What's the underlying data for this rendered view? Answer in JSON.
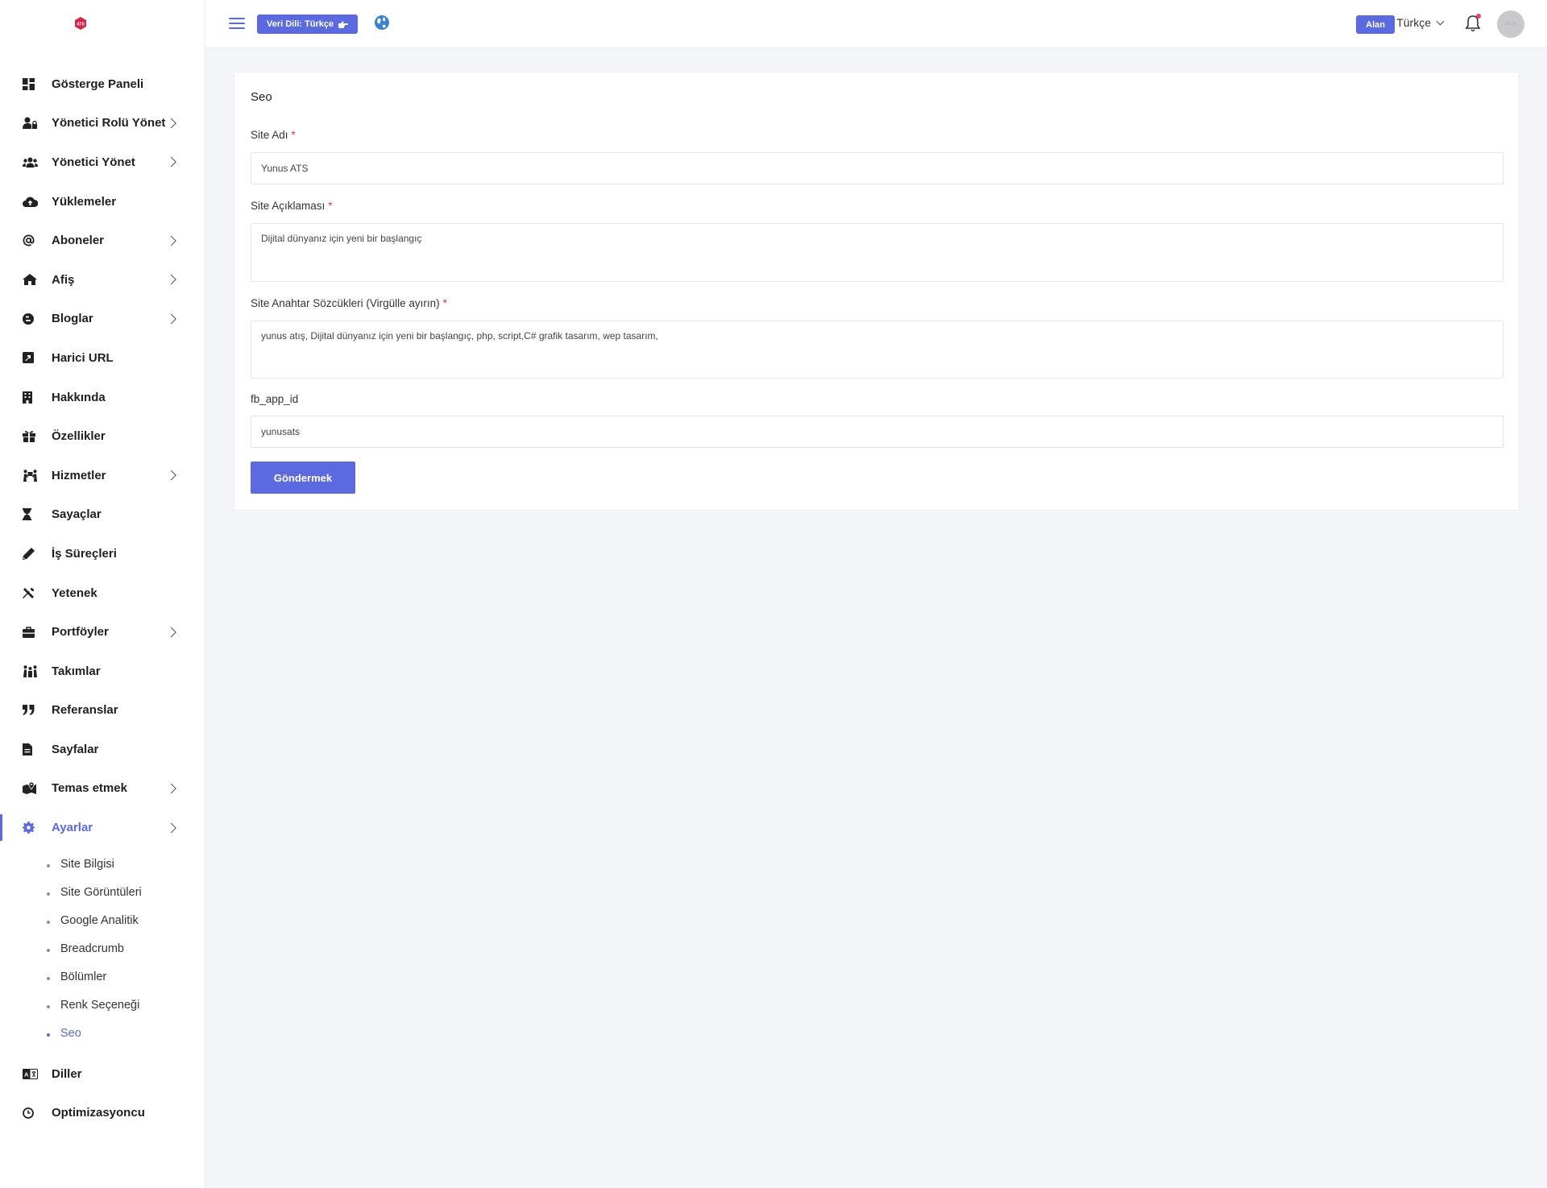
{
  "sidebar": {
    "logo_text": "ATS",
    "items": [
      {
        "label": "Gösterge Paneli",
        "icon": "dashboard-icon",
        "chevron": false
      },
      {
        "label": "Yönetici Rolü Yönet",
        "icon": "user-lock-icon",
        "chevron": true
      },
      {
        "label": "Yönetici Yönet",
        "icon": "users-icon",
        "chevron": true
      },
      {
        "label": "Yüklemeler",
        "icon": "cloud-upload-icon",
        "chevron": false
      },
      {
        "label": "Aboneler",
        "icon": "at-icon",
        "chevron": true
      },
      {
        "label": "Afiş",
        "icon": "home-icon",
        "chevron": true
      },
      {
        "label": "Bloglar",
        "icon": "blog-icon",
        "chevron": true
      },
      {
        "label": "Harici URL",
        "icon": "external-link-icon",
        "chevron": false
      },
      {
        "label": "Hakkında",
        "icon": "building-icon",
        "chevron": false
      },
      {
        "label": "Özellikler",
        "icon": "gift-icon",
        "chevron": false
      },
      {
        "label": "Hizmetler",
        "icon": "people-carry-icon",
        "chevron": true
      },
      {
        "label": "Sayaçlar",
        "icon": "hourglass-icon",
        "chevron": false
      },
      {
        "label": "İş Süreçleri",
        "icon": "pen-icon",
        "chevron": false
      },
      {
        "label": "Yetenek",
        "icon": "tools-icon",
        "chevron": false
      },
      {
        "label": "Portföyler",
        "icon": "briefcase-icon",
        "chevron": true
      },
      {
        "label": "Takımlar",
        "icon": "team-icon",
        "chevron": false
      },
      {
        "label": "Referanslar",
        "icon": "quote-icon",
        "chevron": false
      },
      {
        "label": "Sayfalar",
        "icon": "file-icon",
        "chevron": false
      },
      {
        "label": "Temas etmek",
        "icon": "map-marker-icon",
        "chevron": true
      },
      {
        "label": "Ayarlar",
        "icon": "gear-icon",
        "chevron": true,
        "active": true
      }
    ],
    "settings_submenu": [
      {
        "label": "Site Bilgisi"
      },
      {
        "label": "Site Görüntüleri"
      },
      {
        "label": "Google Analitik"
      },
      {
        "label": "Breadcrumb"
      },
      {
        "label": "Bölümler"
      },
      {
        "label": "Renk Seçeneği"
      },
      {
        "label": "Seo",
        "active": true
      }
    ],
    "bottom_items": [
      {
        "label": "Diller",
        "icon": "language-icon"
      },
      {
        "label": "Optimizasyoncu",
        "icon": "clock-icon"
      }
    ]
  },
  "topbar": {
    "data_language_button": "Veri Dili: Türkçe",
    "alan_button": "Alan",
    "language": "Türkçe",
    "avatar_text": "86x86"
  },
  "form": {
    "title": "Seo",
    "site_name_label": "Site Adı",
    "site_name_value": "Yunus ATS",
    "site_desc_label": "Site Açıklaması",
    "site_desc_value": "Dijital dünyanız için yeni bir başlangıç",
    "keywords_label": "Site Anahtar Sözcükleri (Virgülle ayırın)",
    "keywords_value": "yunus atış, Dijital dünyanız için yeni bir başlangıç, php, script,C# grafik tasarım, wep tasarım,",
    "fb_app_id_label": "fb_app_id",
    "fb_app_id_value": "yunusats",
    "required_mark": "*",
    "submit_label": "Göndermek"
  },
  "colors": {
    "accent": "#5b6ae0",
    "required": "#e03b3b",
    "background": "#f4f5f9"
  }
}
